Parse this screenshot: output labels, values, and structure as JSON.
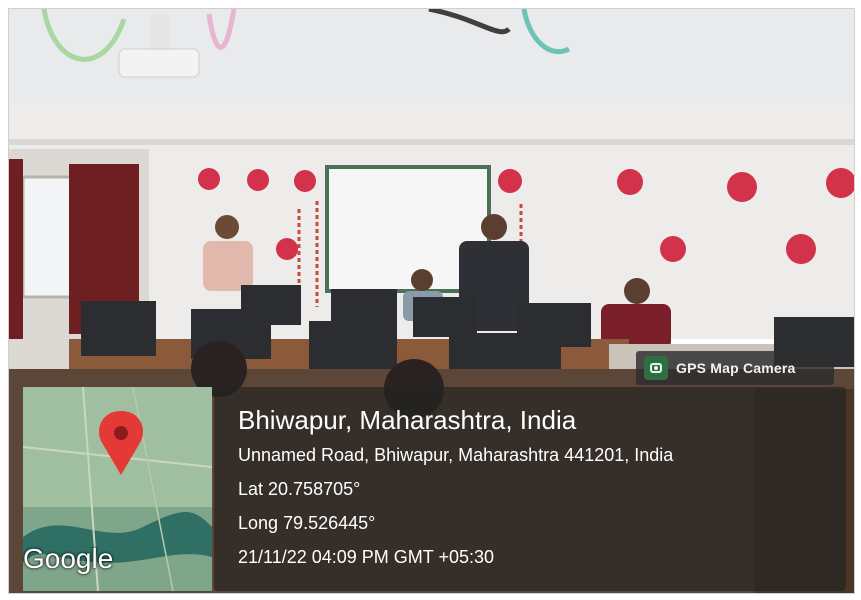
{
  "badge": {
    "label": "GPS Map Camera",
    "icon": "camera-icon"
  },
  "location": {
    "title": "Bhiwapur, Maharashtra, India",
    "address": "Unnamed Road, Bhiwapur, Maharashtra 441201, India",
    "lat": "Lat 20.758705°",
    "long": "Long 79.526445°",
    "datetime": "21/11/22 04:09 PM GMT +05:30"
  },
  "map": {
    "attribution": "Google",
    "pin_color": "#e53935"
  },
  "colors": {
    "wall": "#ecebea",
    "balloon": "#d2334a",
    "desk": "#8a5a3a",
    "curtain": "#6e1f22"
  }
}
